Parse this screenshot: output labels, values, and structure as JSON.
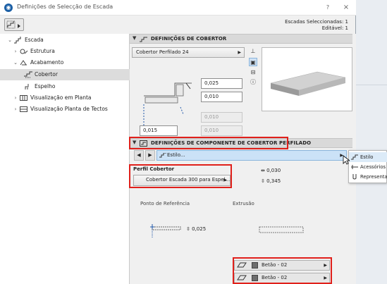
{
  "window": {
    "title": "Definições de Selecção de Escada",
    "help": "?",
    "close": "×"
  },
  "selection": {
    "selected": "Escadas Seleccionadas: 1",
    "editable": "Editável: 1"
  },
  "tree": {
    "items": [
      {
        "label": "Escada"
      },
      {
        "label": "Estrutura"
      },
      {
        "label": "Acabamento"
      },
      {
        "label": "Cobertor"
      },
      {
        "label": "Espelho"
      },
      {
        "label": "Visualização em Planta"
      },
      {
        "label": "Visualização Planta de Tectos"
      }
    ]
  },
  "cover_section": {
    "title": "DEFINIÇÕES DE COBERTOR",
    "type_value": "Cobertor Perfilado 24",
    "field1": "0,025",
    "field2": "0,010",
    "field3": "0,010",
    "field4": "0,010",
    "field5": "0,015"
  },
  "component_section": {
    "title": "DEFINIÇÕES DE COMPONENTE DE COBERTOR PERFILADO",
    "style_label": "Estilo...",
    "profile_title": "Perfil Cobertor",
    "profile_value": "Cobertor Escada 300 para Espel...",
    "dim1": "0,030",
    "dim2": "0,345",
    "ref_point_label": "Ponto de Referência",
    "extrusion_label": "Extrusão",
    "ref_dim": "0,025",
    "materials": [
      {
        "label": "Betão - 02"
      },
      {
        "label": "Betão - 02"
      }
    ]
  },
  "popup_menu": {
    "items": [
      {
        "label": "Estilo"
      },
      {
        "label": "Acessórios"
      },
      {
        "label": "Representação"
      }
    ]
  },
  "colors": {
    "highlight": "#e0201b",
    "selection_blue": "#cbe2f7",
    "tree_selected": "#dcdcdc"
  }
}
